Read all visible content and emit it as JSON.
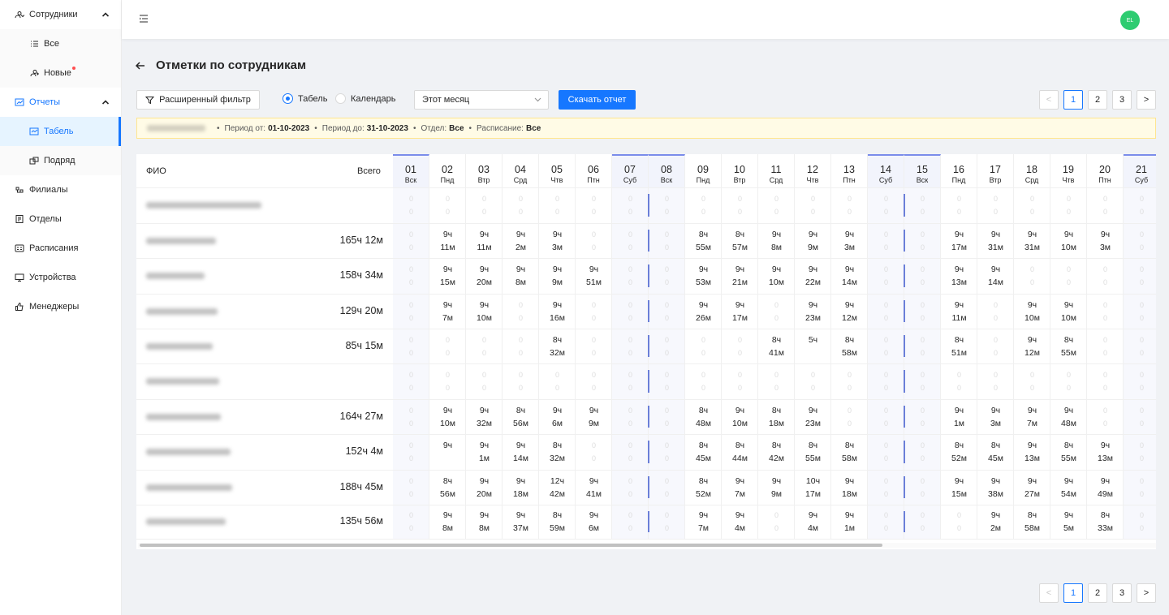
{
  "sidebar": {
    "items": [
      {
        "label": "Сотрудники",
        "icon": "users-icon",
        "caret": "up"
      },
      {
        "label": "Все",
        "icon": "list-icon",
        "sub": true
      },
      {
        "label": "Новые",
        "icon": "user-new-icon",
        "sub": true,
        "badge": true
      },
      {
        "label": "Отчеты",
        "icon": "chart-icon",
        "caret": "up",
        "open": true
      },
      {
        "label": "Табель",
        "icon": "table-icon",
        "sub": true,
        "active": true
      },
      {
        "label": "Подряд",
        "icon": "contract-icon",
        "sub": true
      },
      {
        "label": "Филиалы",
        "icon": "branch-icon"
      },
      {
        "label": "Отделы",
        "icon": "department-icon"
      },
      {
        "label": "Расписания",
        "icon": "schedule-icon"
      },
      {
        "label": "Устройства",
        "icon": "monitor-icon"
      },
      {
        "label": "Менеджеры",
        "icon": "thumbs-up-icon"
      }
    ]
  },
  "topbar": {
    "avatar_text": "EL"
  },
  "page": {
    "title": "Отметки по сотрудникам"
  },
  "toolbar": {
    "filter_label": "Расширенный фильтр",
    "radio_table": "Табель",
    "radio_calendar": "Календарь",
    "period_select": "Этот месяц",
    "download_label": "Скачать отчет"
  },
  "pagination": {
    "prev": "<",
    "pages": [
      "1",
      "2",
      "3"
    ],
    "next": ">",
    "active": "1"
  },
  "info": {
    "period_from_label": "Период от:",
    "period_from": "01-10-2023",
    "period_to_label": "Период до:",
    "period_to": "31-10-2023",
    "dept_label": "Отдел:",
    "dept": "Все",
    "schedule_label": "Расписание:",
    "schedule": "Все",
    "bullet": "•"
  },
  "colors": {
    "accent": "#1677ff",
    "weekend_line": "#6b7fd8",
    "avatar": "#2ecc71"
  },
  "table": {
    "col_fio": "ФИО",
    "col_total": "Всего",
    "days": [
      {
        "n": "01",
        "w": "Вск",
        "weekend": true
      },
      {
        "n": "02",
        "w": "Пнд"
      },
      {
        "n": "03",
        "w": "Втр"
      },
      {
        "n": "04",
        "w": "Срд"
      },
      {
        "n": "05",
        "w": "Чтв"
      },
      {
        "n": "06",
        "w": "Птн"
      },
      {
        "n": "07",
        "w": "Суб",
        "weekend": true
      },
      {
        "n": "08",
        "w": "Вск",
        "weekend": true
      },
      {
        "n": "09",
        "w": "Пнд"
      },
      {
        "n": "10",
        "w": "Втр"
      },
      {
        "n": "11",
        "w": "Срд"
      },
      {
        "n": "12",
        "w": "Чтв"
      },
      {
        "n": "13",
        "w": "Птн"
      },
      {
        "n": "14",
        "w": "Суб",
        "weekend": true
      },
      {
        "n": "15",
        "w": "Вск",
        "weekend": true
      },
      {
        "n": "16",
        "w": "Пнд"
      },
      {
        "n": "17",
        "w": "Втр"
      },
      {
        "n": "18",
        "w": "Срд"
      },
      {
        "n": "19",
        "w": "Чтв"
      },
      {
        "n": "20",
        "w": "Птн"
      },
      {
        "n": "21",
        "w": "Суб",
        "weekend": true
      }
    ],
    "rows": [
      {
        "total": "",
        "cells": [
          "",
          "",
          "",
          "",
          "",
          "",
          "",
          "",
          "",
          "",
          "",
          "",
          "",
          "",
          "",
          "",
          "",
          "",
          "",
          "",
          ""
        ]
      },
      {
        "total": "165ч 12м",
        "cells": [
          "",
          "9ч|11м",
          "9ч|11м",
          "9ч|2м",
          "9ч|3м",
          "",
          "",
          "",
          "8ч|55м",
          "8ч|57м",
          "9ч|8м",
          "9ч|9м",
          "9ч|3м",
          "",
          "",
          "9ч|17м",
          "9ч|31м",
          "9ч|31м",
          "9ч|10м",
          "9ч|3м",
          ""
        ]
      },
      {
        "total": "158ч 34м",
        "cells": [
          "",
          "9ч|15м",
          "9ч|20м",
          "9ч|8м",
          "9ч|9м",
          "9ч|51м",
          "",
          "",
          "9ч|53м",
          "9ч|21м",
          "9ч|10м",
          "9ч|22м",
          "9ч|14м",
          "",
          "",
          "9ч|13м",
          "9ч|14м",
          "",
          "",
          "",
          ""
        ]
      },
      {
        "total": "129ч 20м",
        "cells": [
          "",
          "9ч|7м",
          "9ч|10м",
          "",
          "9ч|16м",
          "",
          "",
          "",
          "9ч|26м",
          "9ч|17м",
          "",
          "9ч|23м",
          "9ч|12м",
          "",
          "",
          "9ч|11м",
          "",
          "9ч|10м",
          "9ч|10м",
          "",
          ""
        ]
      },
      {
        "total": "85ч 15м",
        "cells": [
          "",
          "",
          "",
          "",
          "8ч|32м",
          "",
          "",
          "",
          "",
          "",
          "8ч|41м",
          "5ч|",
          "8ч|58м",
          "",
          "",
          "8ч|51м",
          "",
          "9ч|12м",
          "8ч|55м",
          "",
          ""
        ]
      },
      {
        "total": "",
        "cells": [
          "",
          "",
          "",
          "",
          "",
          "",
          "",
          "",
          "",
          "",
          "",
          "",
          "",
          "",
          "",
          "",
          "",
          "",
          "",
          "",
          ""
        ]
      },
      {
        "total": "164ч 27м",
        "cells": [
          "",
          "9ч|10м",
          "9ч|32м",
          "8ч|56м",
          "9ч|6м",
          "9ч|9м",
          "",
          "",
          "8ч|48м",
          "9ч|10м",
          "8ч|18м",
          "9ч|23м",
          "",
          "",
          "",
          "9ч|1м",
          "9ч|3м",
          "9ч|7м",
          "9ч|48м",
          "",
          ""
        ]
      },
      {
        "total": "152ч 4м",
        "cells": [
          "",
          "9ч|",
          "9ч|1м",
          "9ч|14м",
          "8ч|32м",
          "",
          "",
          "",
          "8ч|45м",
          "8ч|44м",
          "8ч|42м",
          "8ч|55м",
          "8ч|58м",
          "",
          "",
          "8ч|52м",
          "8ч|45м",
          "9ч|13м",
          "8ч|55м",
          "9ч|13м",
          ""
        ]
      },
      {
        "total": "188ч 45м",
        "cells": [
          "",
          "8ч|56м",
          "9ч|20м",
          "9ч|18м",
          "12ч|42м",
          "9ч|41м",
          "",
          "",
          "8ч|52м",
          "9ч|7м",
          "9ч|9м",
          "10ч|17м",
          "9ч|18м",
          "",
          "",
          "9ч|15м",
          "9ч|38м",
          "9ч|27м",
          "9ч|54м",
          "9ч|49м",
          ""
        ]
      },
      {
        "total": "135ч 56м",
        "cells": [
          "",
          "9ч|8м",
          "9ч|8м",
          "9ч|37м",
          "8ч|59м",
          "9ч|6м",
          "",
          "",
          "9ч|7м",
          "9ч|4м",
          "",
          "9ч|4м",
          "9ч|1м",
          "",
          "",
          "",
          "9ч|2м",
          "8ч|58м",
          "9ч|5м",
          "8ч|33м",
          ""
        ]
      }
    ]
  }
}
